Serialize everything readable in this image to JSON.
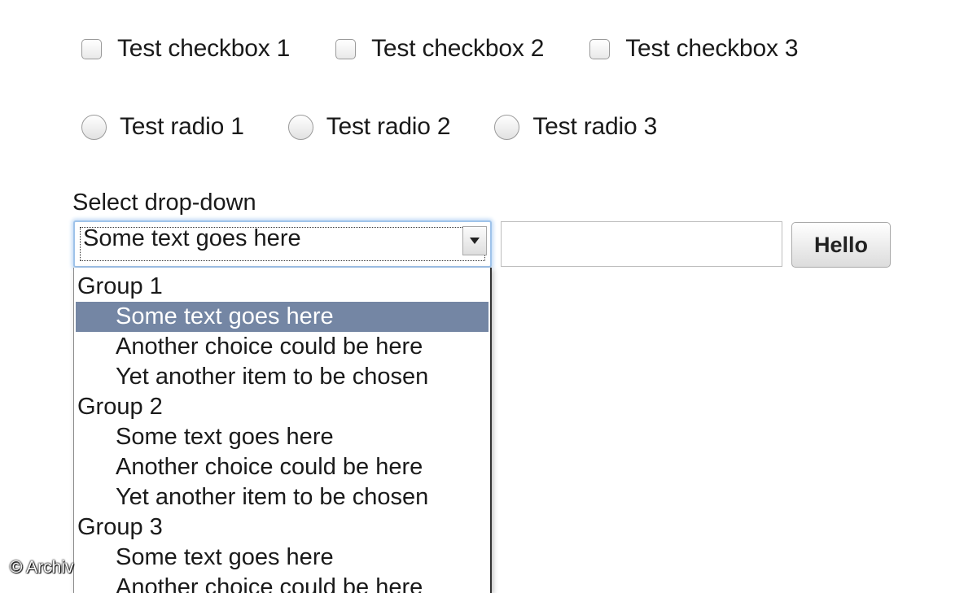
{
  "checkboxes": [
    {
      "label": "Test checkbox 1",
      "checked": false
    },
    {
      "label": "Test checkbox 2",
      "checked": false
    },
    {
      "label": "Test checkbox 3",
      "checked": false
    }
  ],
  "radios": [
    {
      "label": "Test radio 1",
      "selected": false
    },
    {
      "label": "Test radio 2",
      "selected": false
    },
    {
      "label": "Test radio 3",
      "selected": false
    }
  ],
  "select": {
    "label": "Select drop-down",
    "value": "Some text goes here",
    "open": true,
    "highlighted": "Group 1 / Some text goes here",
    "groups": [
      {
        "label": "Group 1",
        "options": [
          "Some text goes here",
          "Another choice could be here",
          "Yet another item to be chosen"
        ]
      },
      {
        "label": "Group 2",
        "options": [
          "Some text goes here",
          "Another choice could be here",
          "Yet another item to be chosen"
        ]
      },
      {
        "label": "Group 3",
        "options": [
          "Some text goes here",
          "Another choice could be here"
        ]
      }
    ]
  },
  "text_input": {
    "value": "",
    "placeholder": ""
  },
  "button": {
    "label": "Hello"
  },
  "watermark": "© Archiv",
  "colors": {
    "highlight_bg": "#7486a4",
    "focus_ring": "#9fc3ea"
  }
}
